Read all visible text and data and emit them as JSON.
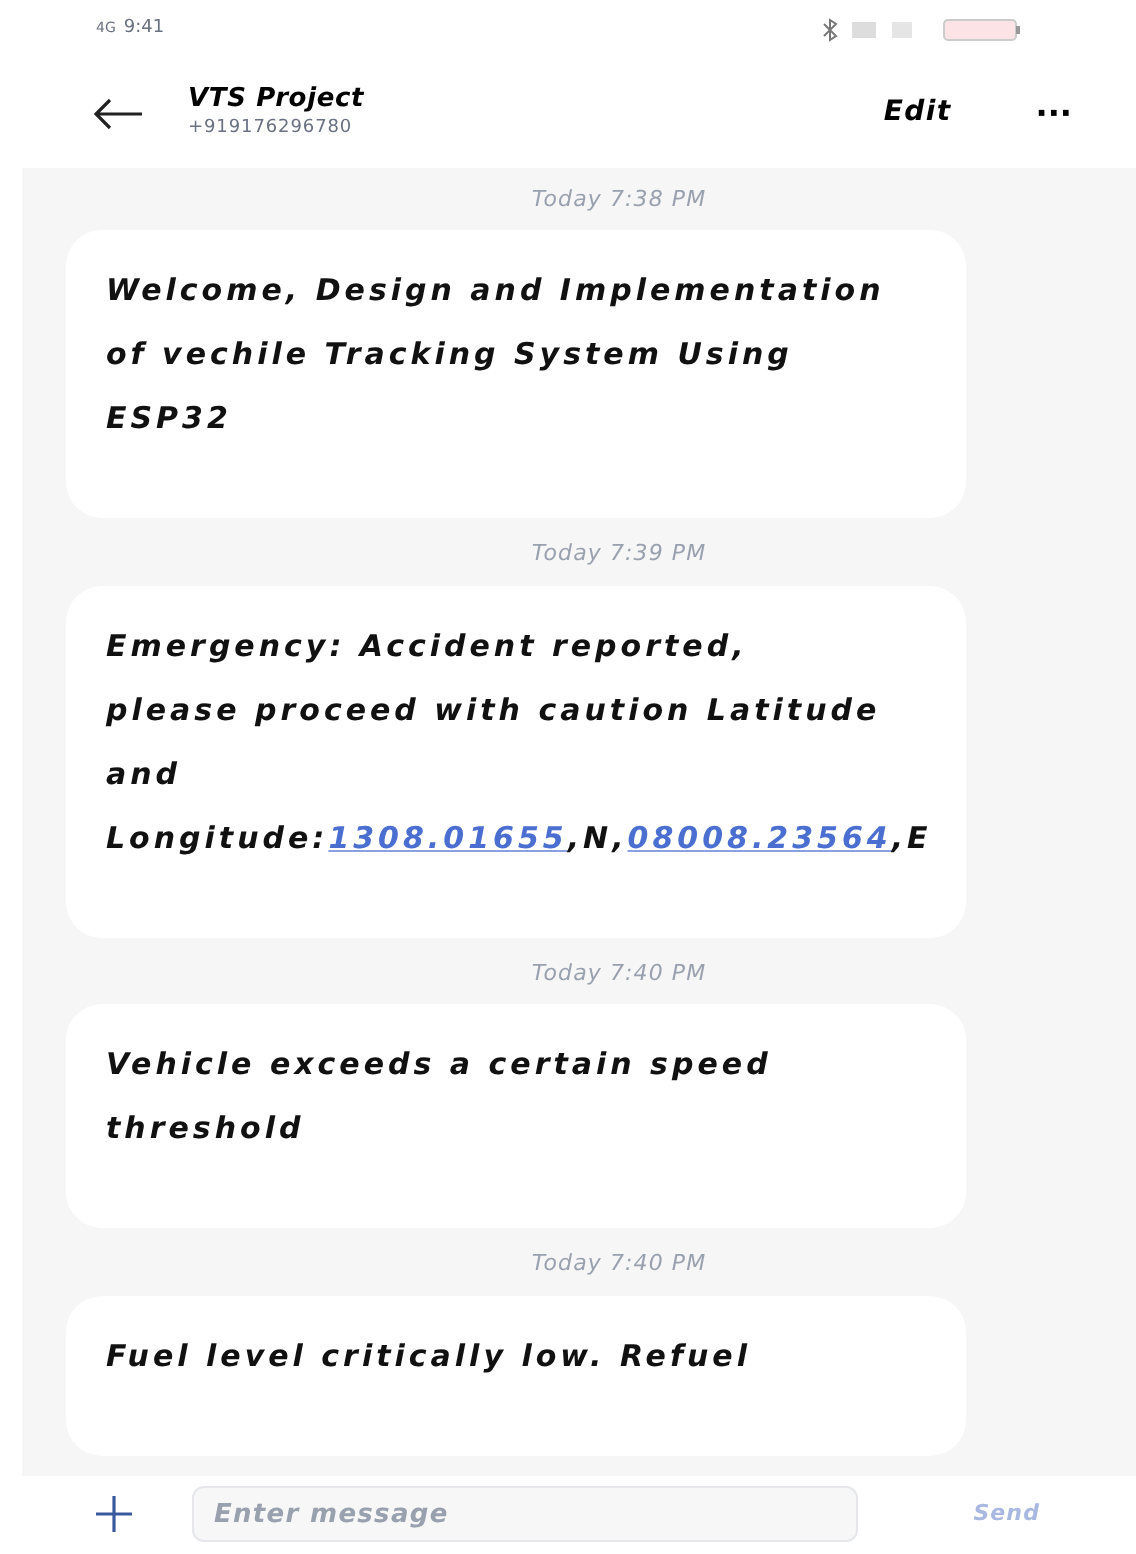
{
  "status_bar": {
    "network": "4G",
    "time": "9:41"
  },
  "header": {
    "title": "VTS Project",
    "subtitle": "+919176296780",
    "edit": "Edit",
    "more": "···"
  },
  "messages": [
    {
      "time": "Today 7:38 PM",
      "parts": [
        {
          "kind": "text",
          "text": "Welcome, Design and Implementation of vechile Tracking System Using ESP32"
        }
      ]
    },
    {
      "time": "Today 7:39 PM",
      "parts": [
        {
          "kind": "text",
          "text": "Emergency: Accident reported, please proceed with caution Latitude and Longitude:"
        },
        {
          "kind": "link",
          "text": "1308.01655"
        },
        {
          "kind": "text",
          "text": ",N,"
        },
        {
          "kind": "link",
          "text": "08008.23564"
        },
        {
          "kind": "text",
          "text": ",E"
        }
      ]
    },
    {
      "time": "Today 7:40 PM",
      "parts": [
        {
          "kind": "text",
          "text": "Vehicle exceeds a certain speed threshold"
        }
      ]
    },
    {
      "time": "Today 7:40 PM",
      "parts": [
        {
          "kind": "text",
          "text": "Fuel level critically low. Refuel"
        }
      ]
    }
  ],
  "composer": {
    "placeholder": "Enter message",
    "send": "Send"
  }
}
